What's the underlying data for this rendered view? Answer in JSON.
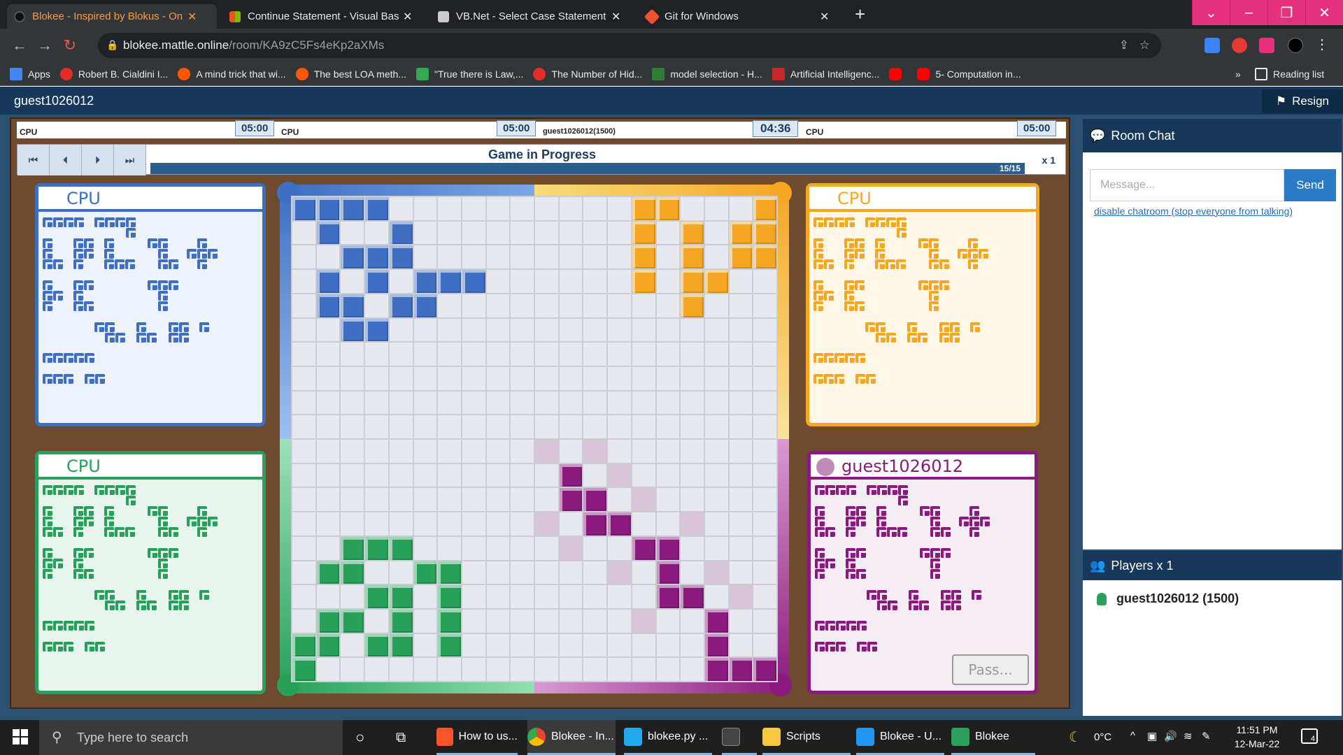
{
  "browser": {
    "tabs": [
      {
        "title": "Blokee - Inspired by Blokus - Onl",
        "active": true,
        "color": "#ff9a3c"
      },
      {
        "title": "Continue Statement - Visual Basic",
        "active": false,
        "color": "#f25022"
      },
      {
        "title": "VB.Net - Select Case Statement",
        "active": false,
        "color": "#cccccc"
      },
      {
        "title": "Git for Windows",
        "active": false,
        "color": "#f05133"
      }
    ],
    "url_domain": "blokee.mattle.online",
    "url_path": "/room/KA9zC5Fs4eKp2aXMs",
    "bookmarks": [
      {
        "label": "Apps",
        "color": "#4285f4"
      },
      {
        "label": "Robert B. Cialdini I...",
        "color": "#e52d27"
      },
      {
        "label": "A mind trick that wi...",
        "color": "#ff5700"
      },
      {
        "label": "The best LOA meth...",
        "color": "#ff5700"
      },
      {
        "label": "\"True there is Law,...",
        "color": "#34a853"
      },
      {
        "label": "The Number of Hid...",
        "color": "#e52d27"
      },
      {
        "label": "model selection - H...",
        "color": "#2e7d32"
      },
      {
        "label": "Artificial Intelligenc...",
        "color": "#c62828"
      },
      {
        "label": "",
        "color": "#ff0000"
      },
      {
        "label": "5- Computation in...",
        "color": "#ff0000"
      }
    ],
    "more": "»",
    "reading_list": "Reading list"
  },
  "site": {
    "username": "guest1026012",
    "resign": "Resign"
  },
  "game": {
    "players_bar": [
      {
        "name": "CPU",
        "time": "05:00"
      },
      {
        "name": "CPU",
        "time": "05:00"
      },
      {
        "name": "guest1026012(1500)",
        "time": "04:36"
      },
      {
        "name": "CPU",
        "time": "05:00"
      }
    ],
    "status": "Game in Progress",
    "progress": "15/15",
    "speed": "x 1",
    "panels": {
      "blue": "CPU",
      "orange": "CPU",
      "green": "CPU",
      "purple": "guest1026012"
    },
    "pass": "Pass...",
    "colors": {
      "blue": "#3e6fc2",
      "orange": "#f5a623",
      "green": "#27a05a",
      "purple": "#8b1a7e",
      "ghost": "#d8c6d8"
    }
  },
  "chat": {
    "title": "Room Chat",
    "placeholder": "Message...",
    "send": "Send",
    "disable": "disable chatroom (stop everyone from talking)"
  },
  "players": {
    "title": "Players x 1",
    "entry": "guest1026012 (1500)"
  },
  "taskbar": {
    "search": "Type here to search",
    "apps": [
      "How to us...",
      "Blokee - In...",
      "blokee.py ...",
      "",
      "Scripts",
      "Blokee - U...",
      "Blokee"
    ],
    "temp": "0°C",
    "time": "11:51 PM",
    "date": "12-Mar-22",
    "notif": "4"
  }
}
